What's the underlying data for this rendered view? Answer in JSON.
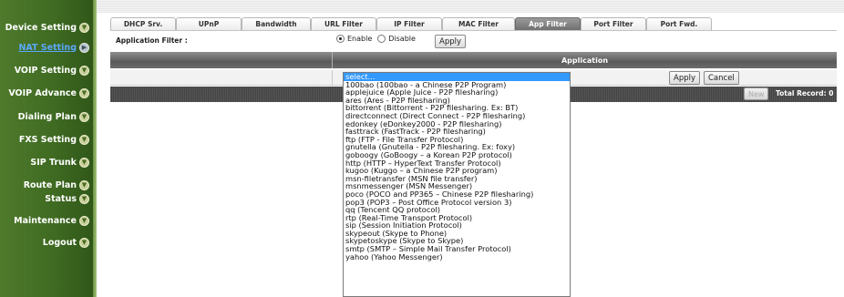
{
  "sidebar": {
    "items": [
      {
        "label": "Device Setting",
        "active": false
      },
      {
        "label": "NAT Setting",
        "active": true
      },
      {
        "label": "VOIP Setting",
        "active": false
      },
      {
        "label": "VOIP Advance",
        "active": false
      },
      {
        "label": "Dialing Plan",
        "active": false
      },
      {
        "label": "FXS Setting",
        "active": false
      },
      {
        "label": "SIP Trunk",
        "active": false
      },
      {
        "label": "Route Plan",
        "active": false
      },
      {
        "label": "Status",
        "active": false
      },
      {
        "label": "Maintenance",
        "active": false
      },
      {
        "label": "Logout",
        "active": false
      }
    ]
  },
  "tabs": [
    {
      "label": "DHCP Srv.",
      "active": false
    },
    {
      "label": "UPnP",
      "active": false
    },
    {
      "label": "Bandwidth",
      "active": false
    },
    {
      "label": "URL Filter",
      "active": false
    },
    {
      "label": "IP Filter",
      "active": false
    },
    {
      "label": "MAC Filter",
      "active": false
    },
    {
      "label": "App Filter",
      "active": true
    },
    {
      "label": "Port Filter",
      "active": false
    },
    {
      "label": "Port Fwd.",
      "active": false
    }
  ],
  "filter": {
    "label": "Application Filter :",
    "enable_label": "Enable",
    "disable_label": "Disable",
    "state": "Enable",
    "apply_label": "Apply"
  },
  "table": {
    "header_application": "Application",
    "apply_label": "Apply",
    "cancel_label": "Cancel",
    "new_label": "New",
    "total_record": "Total Record: 0"
  },
  "dropdown": {
    "selected_index": 0,
    "options": [
      "select...",
      "100bao (100bao - a Chinese P2P Program)",
      "applejuice (Apple Juice - P2P filesharing)",
      "ares (Ares - P2P filesharing)",
      "bittorrent (Bittorrent - P2P filesharing. Ex: BT)",
      "directconnect (Direct Connect - P2P filesharing)",
      "edonkey (eDonkey2000 - P2P filesharing)",
      "fasttrack (FastTrack - P2P filesharing)",
      "ftp (FTP - File Transfer Protocol)",
      "gnutella (Gnutella - P2P filesharing. Ex: foxy)",
      "goboogy (GoBoogy – a Korean P2P protocol)",
      "http (HTTP – HyperText Transfer Protocol)",
      "kugoo (Kuggo – a Chinese P2P program)",
      "msn-filetransfer (MSN file transfer)",
      "msnmessenger (MSN Messenger)",
      "poco (POCO and PP365 – Chinese P2P filesharing)",
      "pop3 (POP3 – Post Office Protocol version 3)",
      "qq (Tencent QQ protocol)",
      "rtp (Real-Time Transport Protocol)",
      "sip (Session Initiation Protocol)",
      "skypeout (Skype to Phone)",
      "skypetoskype (Skype to Skype)",
      "smtp (SMTP – Simple Mail Transfer Protocol)",
      "yahoo (Yahoo Messenger)"
    ]
  }
}
